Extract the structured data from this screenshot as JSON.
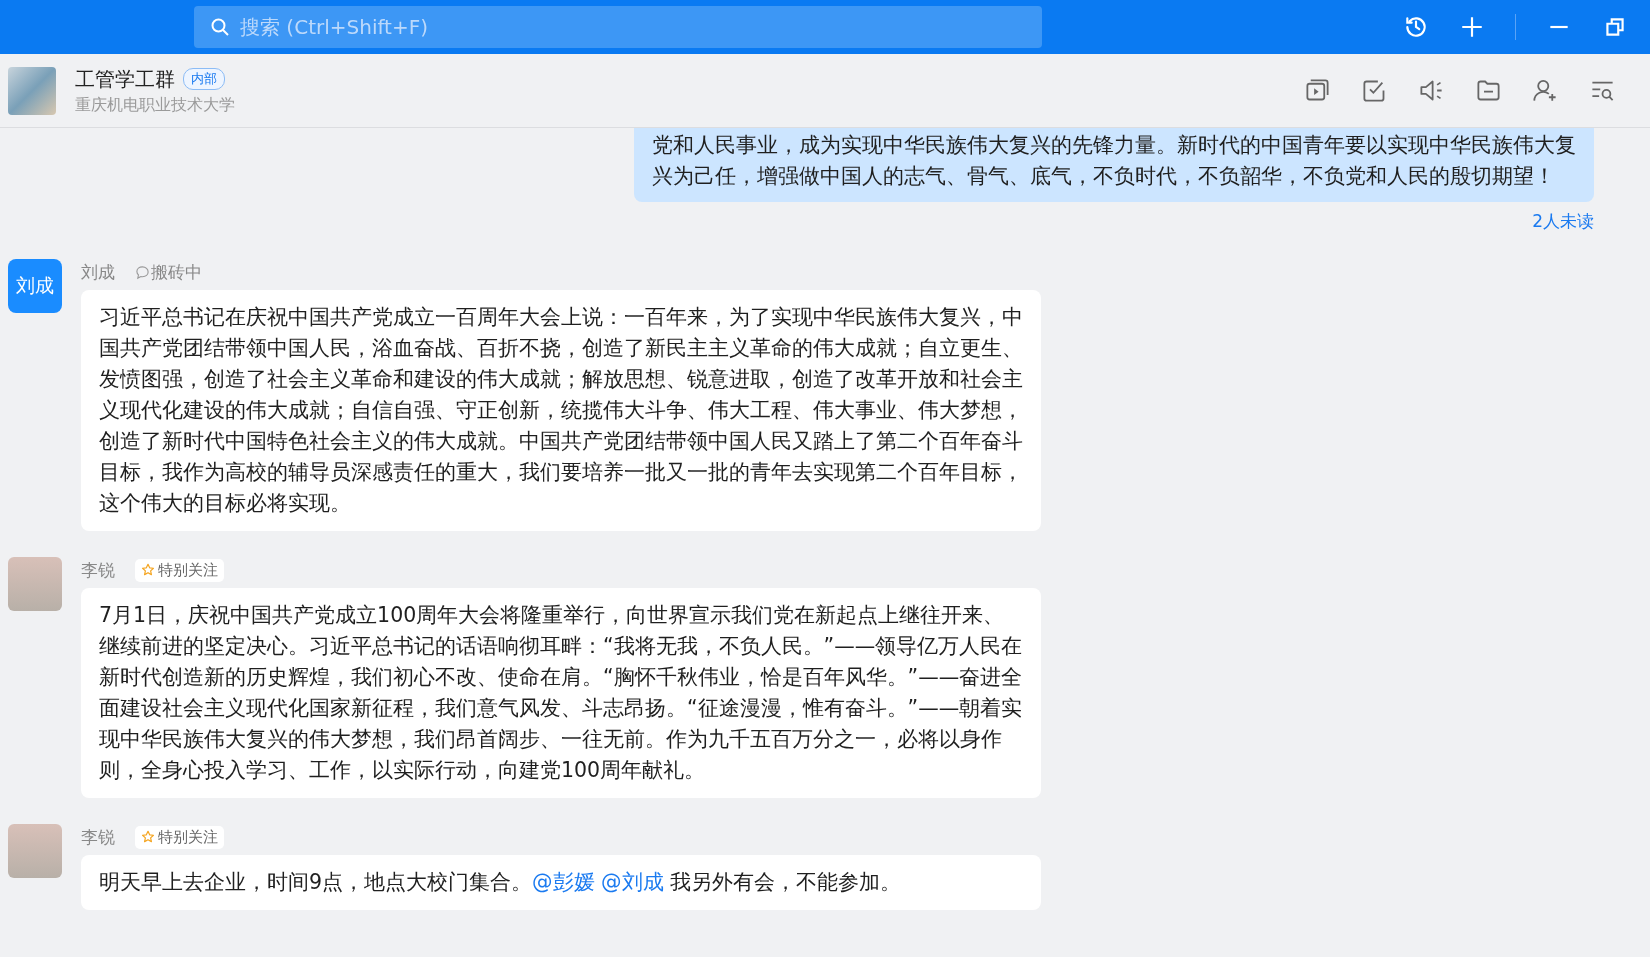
{
  "search": {
    "placeholder": "搜索 (Ctrl+Shift+F)"
  },
  "chat": {
    "name": "工管学工群",
    "tag": "内部",
    "subtitle": "重庆机电职业技术大学"
  },
  "messages": [
    {
      "kind": "own",
      "parts": [
        {
          "kind": "text",
          "text": "党和人民事业，成为实现中华民族伟大复兴的先锋力量。新时代的中国青年要以实现中华民族伟大复兴为己任，增强做中国人的志气、骨气、底气，不负时代，不负韶华，不负党和人民的殷切期望！"
        }
      ],
      "read_status": "2人未读"
    },
    {
      "kind": "other",
      "sender": "刘成",
      "avatar": {
        "kind": "initials",
        "text": "刘成"
      },
      "status": "搬砖中",
      "parts": [
        {
          "kind": "text",
          "text": "习近平总书记在庆祝中国共产党成立一百周年大会上说：一百年来，为了实现中华民族伟大复兴，中国共产党团结带领中国人民，浴血奋战、百折不挠，创造了新民主主义革命的伟大成就；自立更生、发愤图强，创造了社会主义革命和建设的伟大成就；解放思想、锐意进取，创造了改革开放和社会主义现代化建设的伟大成就；自信自强、守正创新，统揽伟大斗争、伟大工程、伟大事业、伟大梦想，创造了新时代中国特色社会主义的伟大成就。中国共产党团结带领中国人民又踏上了第二个百年奋斗目标，我作为高校的辅导员深感责任的重大，我们要培养一批又一批的青年去实现第二个百年目标，这个伟大的目标必将实现。"
        }
      ]
    },
    {
      "kind": "other",
      "sender": "李锐",
      "avatar": {
        "kind": "photo"
      },
      "badge": "特别关注",
      "parts": [
        {
          "kind": "text",
          "text": "7月1日，庆祝中国共产党成立100周年大会将隆重举行，向世界宣示我们党在新起点上继往开来、继续前进的坚定决心。习近平总书记的话语响彻耳畔：“我将无我，不负人民。”——领导亿万人民在新时代创造新的历史辉煌，我们初心不改、使命在肩。“胸怀千秋伟业，恰是百年风华。”——奋进全面建设社会主义现代化国家新征程，我们意气风发、斗志昂扬。“征途漫漫，惟有奋斗。”——朝着实现中华民族伟大复兴的伟大梦想，我们昂首阔步、一往无前。作为九千五百万分之一，必将以身作则，全身心投入学习、工作，以实际行动，向建党100周年献礼。"
        }
      ]
    },
    {
      "kind": "other",
      "sender": "李锐",
      "avatar": {
        "kind": "photo"
      },
      "badge": "特别关注",
      "parts": [
        {
          "kind": "text",
          "text": "明天早上去企业，时间9点，地点大校门集合。"
        },
        {
          "kind": "mention",
          "text": "@彭媛"
        },
        {
          "kind": "mention",
          "text": "@刘成"
        },
        {
          "kind": "text",
          "text": "我另外有会，不能参加。"
        }
      ]
    }
  ]
}
